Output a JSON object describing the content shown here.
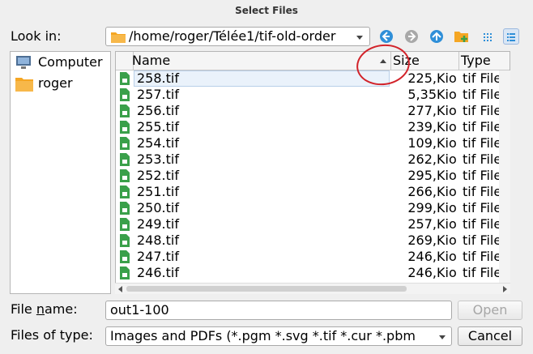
{
  "window": {
    "title": "Select Files"
  },
  "toolbar": {
    "look_in_label": "Look in:",
    "look_in_path": "/home/roger/Télée1/tif-old-order",
    "buttons": [
      "back-icon",
      "forward-icon",
      "parent-directory-icon",
      "new-folder-icon",
      "list-view-icon",
      "detail-view-icon"
    ]
  },
  "sidebar": {
    "items": [
      {
        "label": "Computer",
        "icon": "computer-icon"
      },
      {
        "label": "roger",
        "icon": "folder-icon"
      }
    ]
  },
  "filelist": {
    "columns": [
      "Name",
      "Size",
      "Type"
    ],
    "sorted_column": "Name",
    "rows": [
      {
        "name": "258.tif",
        "size": "225,",
        "unit": "Kio",
        "type": "tif File"
      },
      {
        "name": "257.tif",
        "size": "5,35",
        "unit": "Kio",
        "type": "tif File"
      },
      {
        "name": "256.tif",
        "size": "277,",
        "unit": "Kio",
        "type": "tif File"
      },
      {
        "name": "255.tif",
        "size": "239,",
        "unit": "Kio",
        "type": "tif File"
      },
      {
        "name": "254.tif",
        "size": "109,",
        "unit": "Kio",
        "type": "tif File"
      },
      {
        "name": "253.tif",
        "size": "262,",
        "unit": "Kio",
        "type": "tif File"
      },
      {
        "name": "252.tif",
        "size": "295,",
        "unit": "Kio",
        "type": "tif File"
      },
      {
        "name": "251.tif",
        "size": "266,",
        "unit": "Kio",
        "type": "tif File"
      },
      {
        "name": "250.tif",
        "size": "299,",
        "unit": "Kio",
        "type": "tif File"
      },
      {
        "name": "249.tif",
        "size": "257,",
        "unit": "Kio",
        "type": "tif File"
      },
      {
        "name": "248.tif",
        "size": "269,",
        "unit": "Kio",
        "type": "tif File"
      },
      {
        "name": "247.tif",
        "size": "246,",
        "unit": "Kio",
        "type": "tif File"
      },
      {
        "name": "246.tif",
        "size": "246,",
        "unit": "Kio",
        "type": "tif File"
      }
    ]
  },
  "footer": {
    "file_name_label_pre": "File ",
    "file_name_label_ul": "n",
    "file_name_label_post": "ame:",
    "file_name_value": "out1-100",
    "file_type_label": "Files of type:",
    "file_type_value": "Images and PDFs (*.pgm *.svg *.tif *.cur *.pbm",
    "open_label": "Open",
    "cancel_label": "Cancel"
  },
  "colors": {
    "annotation_circle": "#d2232a",
    "selection": "#eaf2fb",
    "tif_icon": "#3aa04a",
    "folder": "#f5a623"
  }
}
